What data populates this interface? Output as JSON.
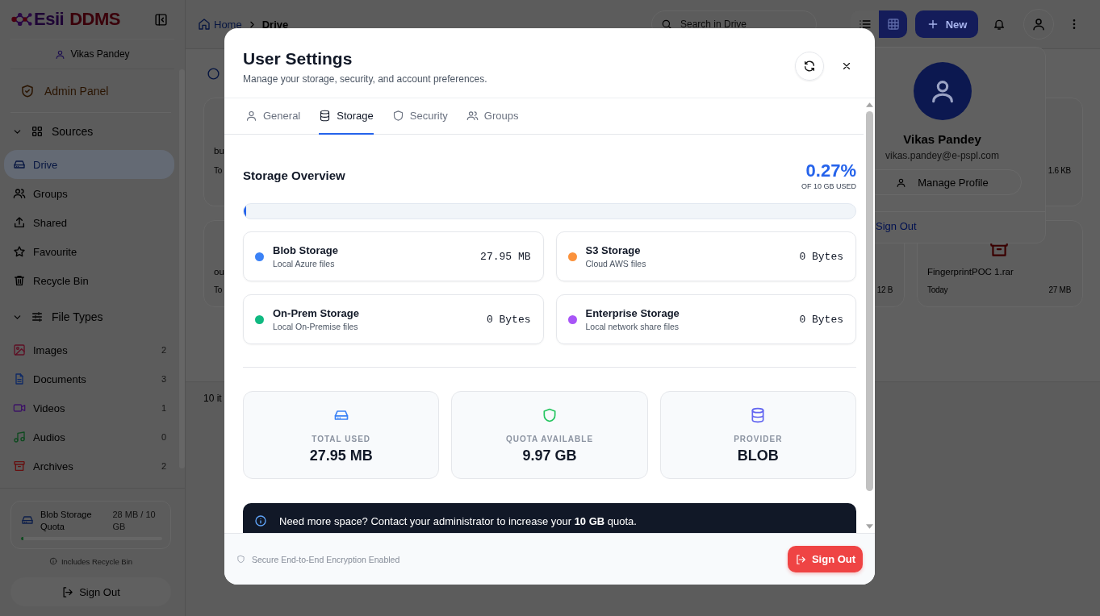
{
  "sidebar": {
    "logo": {
      "first": "Esii",
      "second": "DDMS"
    },
    "user": "Vikas Pandey",
    "admin_panel": "Admin Panel",
    "sections": [
      {
        "label": "Sources",
        "kind": "sources",
        "expanded": true,
        "items": [
          {
            "label": "Drive",
            "kind": "drive",
            "selected": true
          },
          {
            "label": "Groups",
            "kind": "groups",
            "selected": false
          },
          {
            "label": "Shared",
            "kind": "shared",
            "selected": false
          },
          {
            "label": "Favourite",
            "kind": "favourite",
            "selected": false
          },
          {
            "label": "Recycle Bin",
            "kind": "trash",
            "selected": false
          }
        ]
      },
      {
        "label": "File Types",
        "kind": "filetypes",
        "expanded": true,
        "items": [
          {
            "label": "Images",
            "kind": "images",
            "count": "2",
            "selected": false
          },
          {
            "label": "Documents",
            "kind": "documents",
            "count": "3",
            "selected": false
          },
          {
            "label": "Videos",
            "kind": "videos",
            "count": "1",
            "selected": false
          },
          {
            "label": "Audios",
            "kind": "audios",
            "count": "0",
            "selected": false
          },
          {
            "label": "Archives",
            "kind": "archives",
            "count": "2",
            "selected": false
          }
        ]
      }
    ],
    "quota": {
      "label": "Blob Storage Quota",
      "value": "28 MB / 10 GB",
      "level": 0.0027
    },
    "quota_note": "Includes Recycle Bin",
    "sign_out": "Sign Out"
  },
  "topbar": {
    "breadcrumb": [
      "Home",
      "Drive"
    ],
    "search": {
      "placeholder": "Search in Drive"
    },
    "view_modes": [
      {
        "kind": "list",
        "selected": false
      },
      {
        "kind": "table",
        "selected": true
      }
    ],
    "new_button": "New"
  },
  "file_cards": [
    {
      "name": "bu",
      "date": "To"
    },
    {
      "size": "1.6 KB"
    },
    {
      "name": "ou",
      "date": "To"
    },
    {
      "size": "12 B"
    },
    {
      "name": "FingerprintPOC 1.rar",
      "date": "Today",
      "size": "27 MB",
      "kind": "archive"
    }
  ],
  "item_count": "10 it",
  "profile_menu": {
    "name": "Vikas Pandey",
    "email": "vikas.pandey@e-pspl.com",
    "manage": "Manage Profile",
    "sign_out": "Sign Out"
  },
  "dialog": {
    "title": "User Settings",
    "subtitle": "Manage your storage, security, and account preferences.",
    "tabs": [
      {
        "label": "General",
        "kind": "general",
        "selected": false
      },
      {
        "label": "Storage",
        "kind": "storage",
        "selected": true
      },
      {
        "label": "Security",
        "kind": "security",
        "selected": false
      },
      {
        "label": "Groups",
        "kind": "groups",
        "selected": false
      }
    ],
    "overview": {
      "title": "Storage Overview",
      "percent": "0.27%",
      "caption": "OF 10 GB USED",
      "level": 0.0027
    },
    "providers": [
      {
        "name": "Blob Storage",
        "description": "Local Azure files",
        "size": "27.95 MB",
        "color": "#3b82f6"
      },
      {
        "name": "S3 Storage",
        "description": "Cloud AWS files",
        "size": "0 Bytes",
        "color": "#fb923c"
      },
      {
        "name": "On-Prem Storage",
        "description": "Local On-Premise files",
        "size": "0 Bytes",
        "color": "#10b981"
      },
      {
        "name": "Enterprise Storage",
        "description": "Local network share files",
        "size": "0 Bytes",
        "color": "#a855f7"
      }
    ],
    "stats": [
      {
        "kind": "used",
        "label": "TOTAL USED",
        "value": "27.95 MB"
      },
      {
        "kind": "quota",
        "label": "QUOTA AVAILABLE",
        "value": "9.97 GB"
      },
      {
        "kind": "provider",
        "label": "PROVIDER",
        "value": "BLOB"
      }
    ],
    "notice": "Need more space? Contact your administrator to increase your **10 GB** quota.",
    "footer_note": "Secure End-to-End Encryption Enabled",
    "sign_out": "Sign Out"
  }
}
